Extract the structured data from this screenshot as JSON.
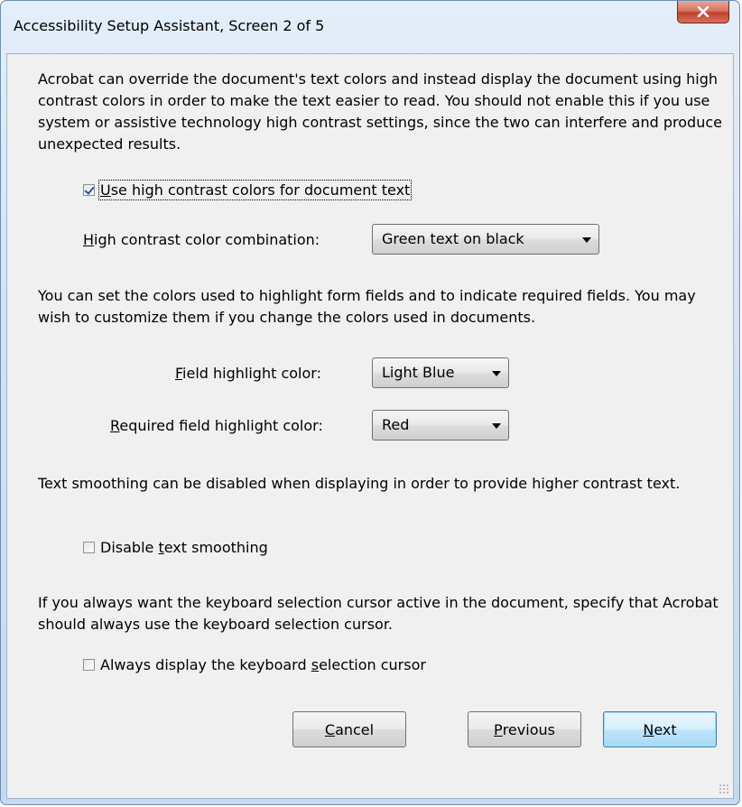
{
  "window": {
    "title": "Accessibility Setup Assistant, Screen 2 of 5",
    "close_icon": "close-icon",
    "close_color": "#c0422b"
  },
  "section1": {
    "text": "Acrobat can override the document's text colors and instead display the document using high contrast colors in order to make the text easier to read. You should not enable this if you use system or assistive technology high contrast settings, since the two can interfere and produce unexpected results.",
    "checkbox": {
      "label_mnemonic": "U",
      "label_rest": "se high contrast colors for document text",
      "checked": true
    },
    "combo_label_mnemonic": "H",
    "combo_label_rest": "igh contrast color combination:",
    "combo_value": "Green text on black"
  },
  "section2": {
    "text": "You can set the colors used to highlight form fields and to indicate required fields. You may wish to customize them if you change the colors used in documents.",
    "field_label_mnemonic": "F",
    "field_label_rest": "ield highlight color:",
    "field_value": "Light Blue",
    "required_label_mnemonic": "R",
    "required_label_rest": "equired field highlight color:",
    "required_value": "Red"
  },
  "section3": {
    "text": "Text smoothing can be disabled when displaying in order to provide higher contrast text.",
    "checkbox": {
      "label_before": "Disable ",
      "label_mnemonic": "t",
      "label_rest": "ext smoothing",
      "checked": false
    }
  },
  "section4": {
    "text": "If you always want the keyboard selection cursor active in the document, specify that Acrobat should always use the keyboard selection cursor.",
    "checkbox": {
      "label_before": "Always display the keyboard ",
      "label_mnemonic": "s",
      "label_rest": "election cursor",
      "checked": false
    }
  },
  "buttons": {
    "cancel_mnemonic": "C",
    "cancel_rest": "ancel",
    "previous_mnemonic": "P",
    "previous_rest": "revious",
    "next_mnemonic": "N",
    "next_rest": "ext"
  }
}
